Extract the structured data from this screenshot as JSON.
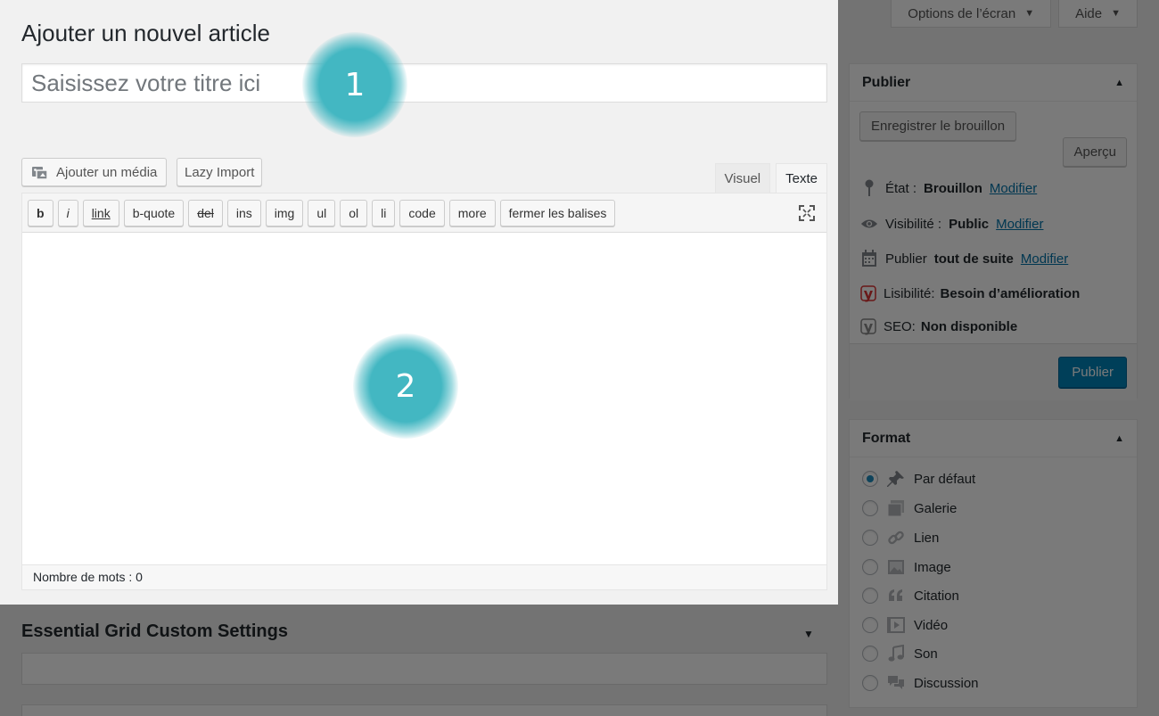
{
  "header": {
    "page_title": "Ajouter un nouvel article",
    "screen_options_label": "Options de l’écran",
    "help_label": "Aide"
  },
  "title_field": {
    "placeholder": "Saisissez votre titre ici",
    "value": ""
  },
  "media": {
    "add_media_label": "Ajouter un média",
    "lazy_import_label": "Lazy Import"
  },
  "editor": {
    "tabs": [
      {
        "label": "Visuel"
      },
      {
        "label": "Texte",
        "active": true
      }
    ],
    "quicktags": [
      "b",
      "i",
      "link",
      "b-quote",
      "del",
      "ins",
      "img",
      "ul",
      "ol",
      "li",
      "code",
      "more",
      "fermer les balises"
    ],
    "word_count": "Nombre de mots : 0"
  },
  "essential_grid": {
    "title": "Essential Grid Custom Settings"
  },
  "publish_box": {
    "title": "Publier",
    "save_draft_label": "Enregistrer le brouillon",
    "preview_label": "Aperçu",
    "status_label": "État :",
    "status_value": "Brouillon",
    "visibility_label": "Visibilité :",
    "visibility_value": "Public",
    "schedule_label": "Publier",
    "schedule_value": "tout de suite",
    "edit_link": "Modifier",
    "readability_label": "Lisibilité:",
    "readability_value": "Besoin d’amélioration",
    "seo_label": "SEO:",
    "seo_value": "Non disponible",
    "publish_label": "Publier"
  },
  "format_box": {
    "title": "Format",
    "options": [
      {
        "label": "Par défaut",
        "icon": "pin-icon",
        "checked": true
      },
      {
        "label": "Galerie",
        "icon": "gallery-icon"
      },
      {
        "label": "Lien",
        "icon": "link-icon"
      },
      {
        "label": "Image",
        "icon": "image-icon"
      },
      {
        "label": "Citation",
        "icon": "quote-icon"
      },
      {
        "label": "Vidéo",
        "icon": "video-icon"
      },
      {
        "label": "Son",
        "icon": "audio-icon"
      },
      {
        "label": "Discussion",
        "icon": "chat-icon"
      }
    ]
  },
  "markers": [
    {
      "label": "1"
    },
    {
      "label": "2"
    }
  ],
  "colors": {
    "accent": "#0085ba",
    "marker": "#43b7c2",
    "link": "#0073aa"
  }
}
